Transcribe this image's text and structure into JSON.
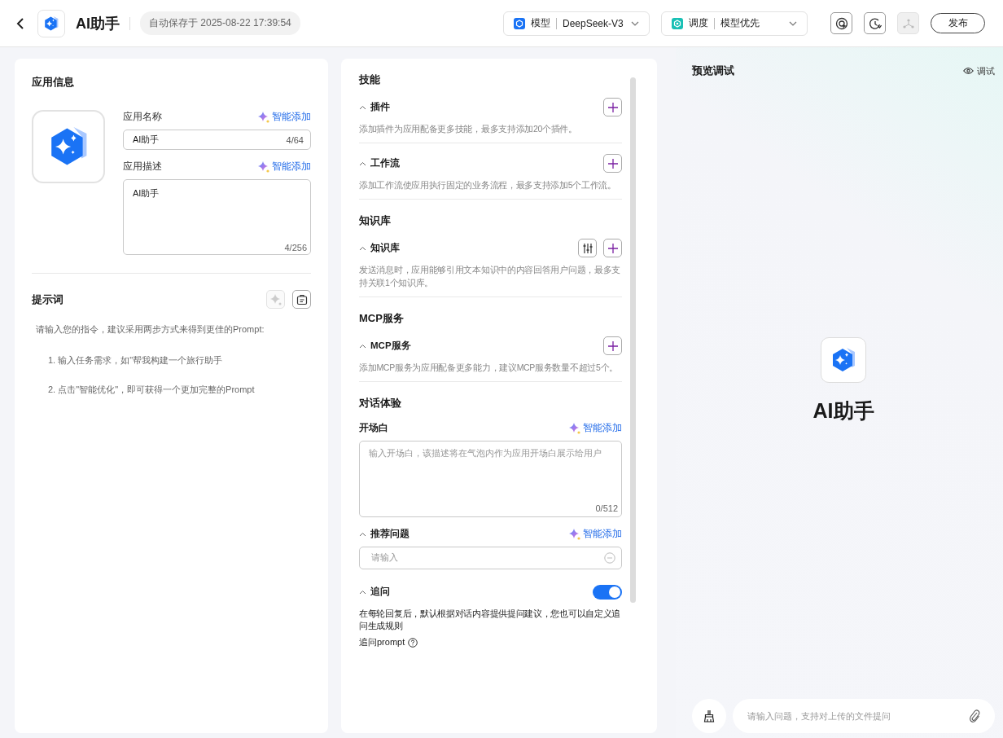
{
  "header": {
    "title": "AI助手",
    "autosave": "自动保存于 2025-08-22 17:39:54",
    "selectors": [
      {
        "kind": "model",
        "label": "模型",
        "value": "DeepSeek-V3"
      },
      {
        "kind": "schedule",
        "label": "调度",
        "value": "模型优先"
      }
    ],
    "tools": [
      {
        "kind": "target",
        "disabled": false
      },
      {
        "kind": "history",
        "disabled": false
      },
      {
        "kind": "graph",
        "disabled": true
      }
    ],
    "publish": "发布"
  },
  "app_info": {
    "title": "应用信息",
    "fields": [
      {
        "label": "应用名称",
        "ai_action": "智能添加",
        "value": "AI助手",
        "counter": "4/64",
        "multiline": false
      },
      {
        "label": "应用描述",
        "ai_action": "智能添加",
        "value": "AI助手",
        "counter": "4/256",
        "multiline": true
      }
    ]
  },
  "prompt": {
    "title": "提示词",
    "optimize_disabled": true,
    "intro": "请输入您的指令，建议采用两步方式来得到更佳的Prompt:",
    "steps": [
      "1. 输入任务需求，如\"帮我构建一个旅行助手",
      "2. 点击\"智能优化\"，即可获得一个更加完整的Prompt"
    ]
  },
  "config": {
    "sections": [
      {
        "title": "技能",
        "groups": [
          {
            "title": "插件",
            "expanded": true,
            "has_settings": false,
            "description": "添加插件为应用配备更多技能，最多支持添加20个插件。"
          },
          {
            "title": "工作流",
            "expanded": true,
            "has_settings": false,
            "description": "添加工作流使应用执行固定的业务流程，最多支持添加5个工作流。"
          }
        ]
      },
      {
        "title": "知识库",
        "groups": [
          {
            "title": "知识库",
            "expanded": true,
            "has_settings": true,
            "description": "发送消息时，应用能够引用文本知识中的内容回答用户问题，最多支持关联1个知识库。"
          }
        ]
      },
      {
        "title": "MCP服务",
        "groups": [
          {
            "title": "MCP服务",
            "expanded": true,
            "has_settings": false,
            "description": "添加MCP服务为应用配备更多能力，建议MCP服务数量不超过5个。"
          }
        ]
      }
    ],
    "dialog": {
      "title": "对话体验",
      "opening": {
        "label": "开场白",
        "ai_action": "智能添加",
        "placeholder": "输入开场白，该描述将在气泡内作为应用开场白展示给用户",
        "counter": "0/512"
      },
      "suggested": {
        "title": "推荐问题",
        "expanded": true,
        "ai_action": "智能添加",
        "placeholder": "请输入"
      },
      "followup": {
        "title": "追问",
        "expanded": true,
        "on": true,
        "description": "在每轮回复后，默认根据对话内容提供提问建议，您也可以自定义追问生成规则",
        "prompt_label": "追问prompt"
      }
    }
  },
  "preview": {
    "title": "预览调试",
    "debug": "调试",
    "app_name": "AI助手",
    "chat_placeholder": "请输入问题，支持对上传的文件提问"
  }
}
